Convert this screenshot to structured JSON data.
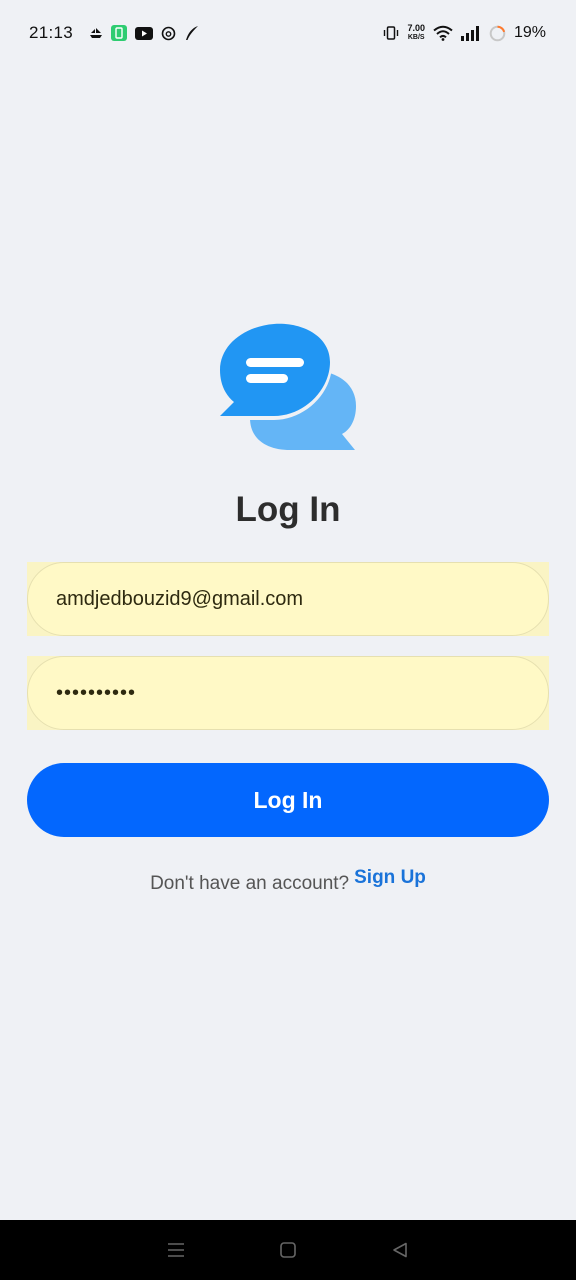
{
  "status_bar": {
    "time": "21:13",
    "network_speed_value": "7.00",
    "network_speed_unit": "KB/S",
    "battery_percent": "19%",
    "icons": [
      "boat-icon",
      "battery-saver-icon",
      "youtube-icon",
      "threads-icon",
      "feather-icon",
      "vibrate-icon",
      "wifi-icon",
      "signal-icon",
      "battery-ring-icon"
    ]
  },
  "brand": {
    "logo_icon": "chat-bubbles-icon",
    "primary": "#2196f3",
    "secondary": "#64b5f6"
  },
  "page": {
    "title": "Log In"
  },
  "form": {
    "email_value": "amdjedbouzid9@gmail.com",
    "password_value": "••••••••••"
  },
  "actions": {
    "login_label": "Log In",
    "login_color": "#0367fe"
  },
  "footer": {
    "prompt": "Don't have an account?",
    "signup_label": "Sign Up"
  },
  "nav": {
    "icons": [
      "menu-icon",
      "home-icon",
      "back-icon"
    ]
  }
}
